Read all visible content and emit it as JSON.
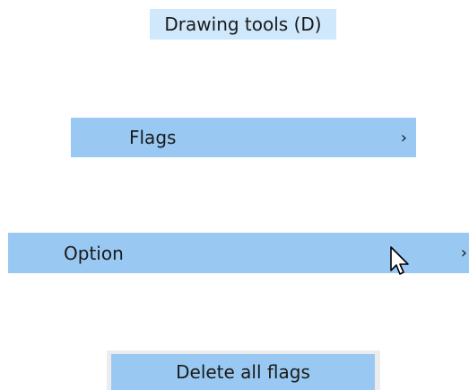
{
  "title": {
    "text": "Drawing tools (D)"
  },
  "menu": {
    "flags": {
      "label": "Flags",
      "submenu_icon": "chevron-right-icon",
      "submenu_glyph": "›"
    },
    "option": {
      "label": "Option",
      "submenu_icon": "chevron-right-icon",
      "submenu_glyph": "›"
    },
    "delete_all_flags": {
      "label": "Delete all flags"
    }
  },
  "cursor": {
    "icon": "arrow-pointer-icon"
  },
  "colors": {
    "highlight": "#99c9f3",
    "title_bg": "#cfe8fb",
    "text": "#1a1a1a",
    "background": "#ffffff"
  }
}
